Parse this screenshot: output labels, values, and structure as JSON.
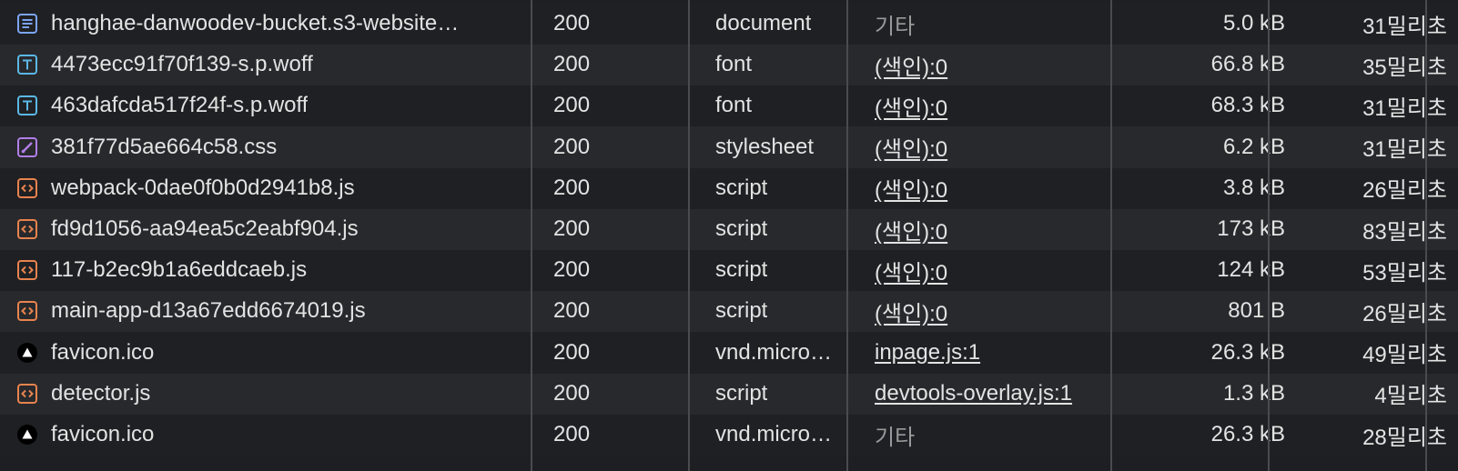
{
  "rows": [
    {
      "name": "hanghae-danwoodev-bucket.s3-website…",
      "icon": "document-icon",
      "status": "200",
      "type": "document",
      "initiator": "기타",
      "initiator_link": false,
      "size": "5.0 kB",
      "time": "31밀리초"
    },
    {
      "name": "4473ecc91f70f139-s.p.woff",
      "icon": "font-icon",
      "status": "200",
      "type": "font",
      "initiator": "(색인):0",
      "initiator_link": true,
      "size": "66.8 kB",
      "time": "35밀리초"
    },
    {
      "name": "463dafcda517f24f-s.p.woff",
      "icon": "font-icon",
      "status": "200",
      "type": "font",
      "initiator": "(색인):0",
      "initiator_link": true,
      "size": "68.3 kB",
      "time": "31밀리초"
    },
    {
      "name": "381f77d5ae664c58.css",
      "icon": "stylesheet-icon",
      "status": "200",
      "type": "stylesheet",
      "initiator": "(색인):0",
      "initiator_link": true,
      "size": "6.2 kB",
      "time": "31밀리초"
    },
    {
      "name": "webpack-0dae0f0b0d2941b8.js",
      "icon": "script-icon",
      "status": "200",
      "type": "script",
      "initiator": "(색인):0",
      "initiator_link": true,
      "size": "3.8 kB",
      "time": "26밀리초"
    },
    {
      "name": "fd9d1056-aa94ea5c2eabf904.js",
      "icon": "script-icon",
      "status": "200",
      "type": "script",
      "initiator": "(색인):0",
      "initiator_link": true,
      "size": "173 kB",
      "time": "83밀리초"
    },
    {
      "name": "117-b2ec9b1a6eddcaeb.js",
      "icon": "script-icon",
      "status": "200",
      "type": "script",
      "initiator": "(색인):0",
      "initiator_link": true,
      "size": "124 kB",
      "time": "53밀리초"
    },
    {
      "name": "main-app-d13a67edd6674019.js",
      "icon": "script-icon",
      "status": "200",
      "type": "script",
      "initiator": "(색인):0",
      "initiator_link": true,
      "size": "801 B",
      "time": "26밀리초"
    },
    {
      "name": "favicon.ico",
      "icon": "favicon-icon",
      "status": "200",
      "type": "vnd.micro…",
      "initiator": "inpage.js:1",
      "initiator_link": true,
      "size": "26.3 kB",
      "time": "49밀리초"
    },
    {
      "name": "detector.js",
      "icon": "script-icon",
      "status": "200",
      "type": "script",
      "initiator": "devtools-overlay.js:1",
      "initiator_link": true,
      "size": "1.3 kB",
      "time": "4밀리초"
    },
    {
      "name": "favicon.ico",
      "icon": "favicon-icon",
      "status": "200",
      "type": "vnd.micro…",
      "initiator": "기타",
      "initiator_link": false,
      "size": "26.3 kB",
      "time": "28밀리초"
    }
  ],
  "colors": {
    "document_icon": "#7ba4f5",
    "font_icon": "#5bb8e6",
    "stylesheet_icon": "#b17ee8",
    "script_icon": "#e8834e",
    "favicon_bg": "#000000"
  }
}
